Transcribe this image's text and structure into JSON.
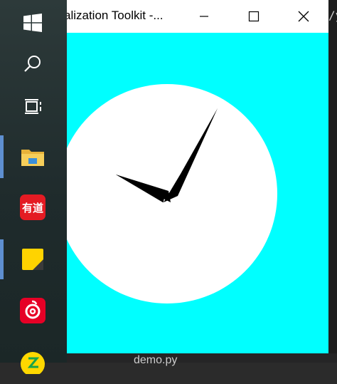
{
  "window": {
    "title": "alization Toolkit -...",
    "background_color": "#00ffff",
    "controls": {
      "minimize_icon": "minimize-icon",
      "maximize_icon": "maximize-icon",
      "close_icon": "close-icon"
    },
    "clock": {
      "face_color": "#ffffff",
      "hand_color": "#000000"
    }
  },
  "taskbar": {
    "items": [
      {
        "name": "start",
        "icon": "windows-logo-icon"
      },
      {
        "name": "search",
        "icon": "search-icon"
      },
      {
        "name": "task-view",
        "icon": "task-view-icon"
      },
      {
        "name": "file-explorer",
        "icon": "folder-icon"
      },
      {
        "name": "youdao",
        "icon": "youdao-icon",
        "label": "有道"
      },
      {
        "name": "sticky-notes",
        "icon": "sticky-notes-icon"
      },
      {
        "name": "netease-music",
        "icon": "netease-music-icon"
      },
      {
        "name": "app",
        "icon": "app-icon"
      }
    ]
  },
  "background": {
    "right_snippet": "/y",
    "bottom_snippet": "demo.py"
  }
}
